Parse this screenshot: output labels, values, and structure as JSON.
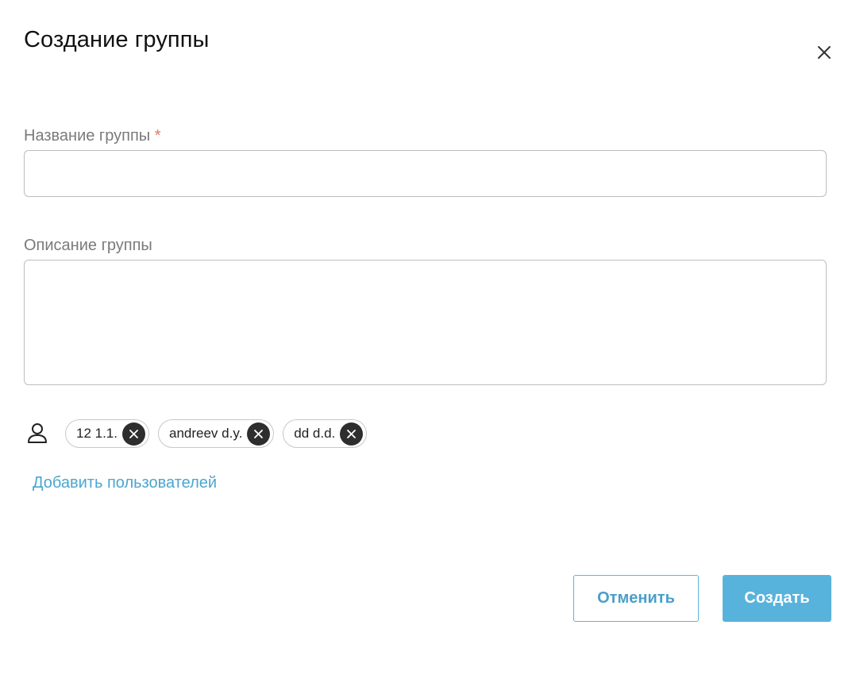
{
  "dialog": {
    "title": "Создание группы",
    "close_icon": "close-icon"
  },
  "form": {
    "name_label": "Название группы",
    "name_required_mark": "*",
    "name_value": "",
    "description_label": "Описание группы",
    "description_value": ""
  },
  "users": {
    "icon": "user-icon",
    "chips": [
      {
        "label": "12 1.1."
      },
      {
        "label": "andreev d.y."
      },
      {
        "label": "dd d.d."
      }
    ],
    "add_link": "Добавить пользователей"
  },
  "actions": {
    "cancel_label": "Отменить",
    "create_label": "Создать"
  },
  "colors": {
    "accent": "#58b3dc",
    "link": "#4aa6d0",
    "required": "#e0786b",
    "chip_remove_bg": "#2e2e2e"
  }
}
